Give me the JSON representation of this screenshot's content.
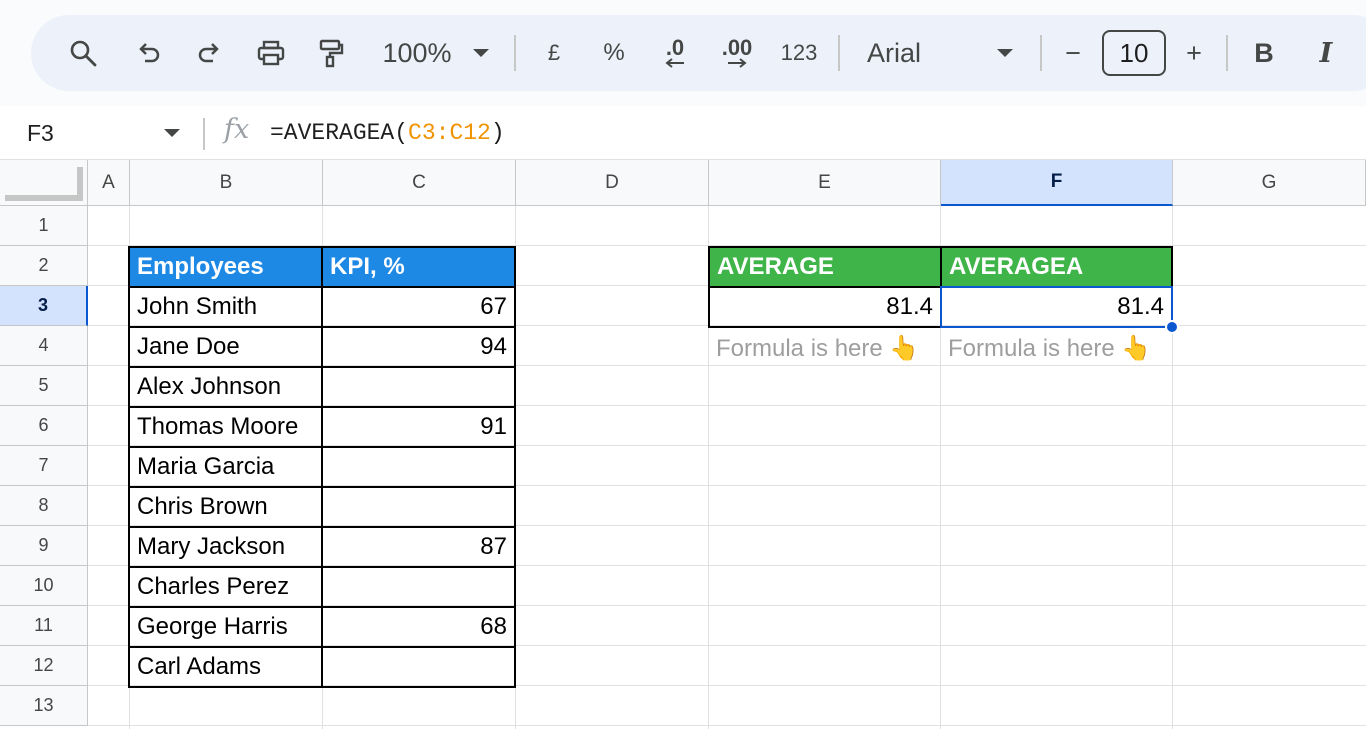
{
  "toolbar": {
    "zoom": "100%",
    "currency_label": "£",
    "percent_label": "%",
    "decrease_decimal_label": ".0",
    "increase_decimal_label": ".00",
    "number_format_label": "123",
    "font_name": "Arial",
    "font_size": "10",
    "bold_label": "B",
    "italic_label": "I",
    "decrease_size_label": "−",
    "increase_size_label": "+"
  },
  "formula_bar": {
    "cell_ref": "F3",
    "fx_label": "fx",
    "formula_prefix": "=AVERAGEA(",
    "formula_range": "C3:C12",
    "formula_suffix": ")"
  },
  "columns": [
    "A",
    "B",
    "C",
    "D",
    "E",
    "F",
    "G"
  ],
  "rows": [
    "1",
    "2",
    "3",
    "4",
    "5",
    "6",
    "7",
    "8",
    "9",
    "10",
    "11",
    "12",
    "13"
  ],
  "selected_column": "F",
  "selected_row": "3",
  "table": {
    "headers": [
      "Employees",
      "KPI, %"
    ],
    "rows": [
      {
        "name": "John Smith",
        "kpi": "67"
      },
      {
        "name": "Jane Doe",
        "kpi": "94"
      },
      {
        "name": "Alex Johnson",
        "kpi": ""
      },
      {
        "name": "Thomas Moore",
        "kpi": "91"
      },
      {
        "name": "Maria Garcia",
        "kpi": ""
      },
      {
        "name": "Chris Brown",
        "kpi": ""
      },
      {
        "name": "Mary Jackson",
        "kpi": "87"
      },
      {
        "name": "Charles Perez",
        "kpi": ""
      },
      {
        "name": "George Harris",
        "kpi": "68"
      },
      {
        "name": "Carl Adams",
        "kpi": ""
      }
    ]
  },
  "results": {
    "average_header": "AVERAGE",
    "averagea_header": "AVERAGEA",
    "average_value": "81.4",
    "averagea_value": "81.4",
    "note_e": "Formula is here 👆",
    "note_f": "Formula is here 👆"
  },
  "colors": {
    "header_blue": "#1e88e5",
    "header_green": "#3fb449",
    "selection": "#0b57d0",
    "formula_range": "#f09300"
  }
}
